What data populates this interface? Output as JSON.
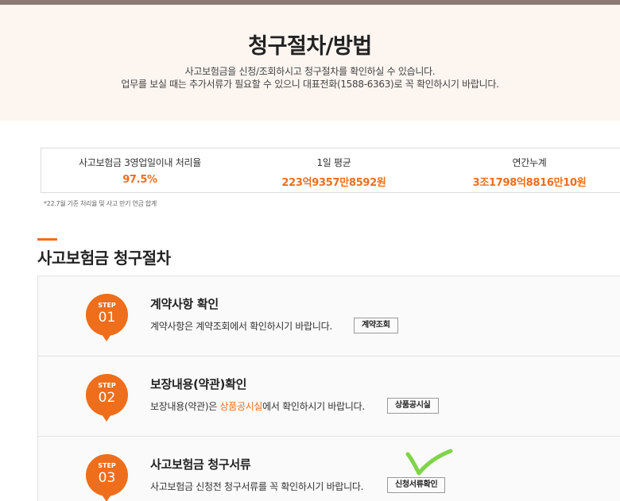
{
  "header": {
    "title": "청구절차/방법",
    "desc_line1": "사고보험금을 신청/조회하시고 청구절차를 확인하실 수 있습니다.",
    "desc_line2": "업무를 보실 때는 추가서류가 필요할 수 있으니 대표전화(1588-6363)로 꼭 확인하시기 바랍니다."
  },
  "stats": {
    "items": [
      {
        "label": "사고보험금 3영업일이내 처리율",
        "value": "97.5%"
      },
      {
        "label": "1일 평균",
        "value": "223억9357만8592원"
      },
      {
        "label": "연간누계",
        "value": "3조1798억8816만10원"
      }
    ],
    "footnote": "*22.7월 기준 처리율 및 사고 만기 연금 합계"
  },
  "section": {
    "title": "사고보험금 청구절차"
  },
  "steps": [
    {
      "badge_label": "STEP",
      "number": "01",
      "title": "계약사항 확인",
      "desc": "계약사항은 계약조회에서 확인하시기 바랍니다.",
      "button": "계약조회"
    },
    {
      "badge_label": "STEP",
      "number": "02",
      "title": "보장내용(약관)확인",
      "desc_before": "보장내용(약관)은 ",
      "desc_highlight": "상품공시실",
      "desc_after": "에서 확인하시기 바랍니다.",
      "button": "상품공시실"
    },
    {
      "badge_label": "STEP",
      "number": "03",
      "title": "사고보험금 청구서류",
      "desc": "사고보험금 신청전 청구서류를 꼭 확인하시기 바랍니다.",
      "button": "신청서류확인"
    }
  ],
  "colors": {
    "accent": "#ee6e1c",
    "hero_bg": "#fcf5f0",
    "check_mark": "#7fd44a"
  },
  "icons": {
    "annotation": "checkmark-icon"
  }
}
